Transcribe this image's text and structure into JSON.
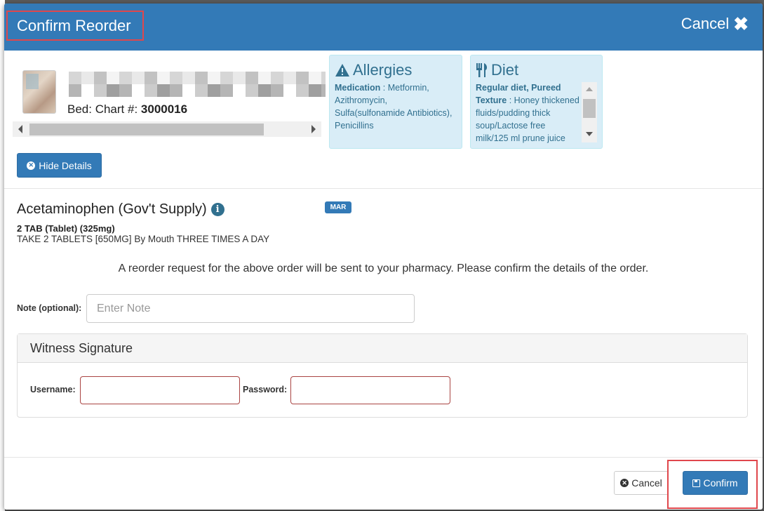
{
  "header": {
    "title": "Confirm Reorder",
    "cancel_label": "Cancel"
  },
  "patient": {
    "bed_label": "Bed: Chart #:",
    "chart_number": "3000016"
  },
  "allergies": {
    "title": "Allergies",
    "label": "Medication",
    "value": ": Metformin, Azithromycin, Sulfa(sulfonamide Antibiotics), Penicillins"
  },
  "diet": {
    "title": "Diet",
    "diet_type": "Regular diet, Pureed",
    "texture_label": "Texture",
    "texture_value": ": Honey thickened fluids/pudding thick soup/Lactose free milk/125 ml prune juice"
  },
  "hide_details_label": "Hide Details",
  "order": {
    "drug_name": "Acetaminophen (Gov't Supply)",
    "badge": "MAR",
    "dose": "2 TAB (Tablet) (325mg)",
    "instructions": "TAKE 2 TABLETS [650MG] By Mouth THREE TIMES A DAY"
  },
  "notice": "A reorder request for the above order will be sent to your pharmacy. Please confirm the details of the order.",
  "note": {
    "label": "Note (optional):",
    "placeholder": "Enter Note",
    "value": ""
  },
  "witness": {
    "title": "Witness Signature",
    "username_label": "Username:",
    "password_label": "Password:"
  },
  "footer": {
    "cancel_label": "Cancel",
    "confirm_label": "Confirm"
  },
  "colors": {
    "primary": "#337ab7",
    "info_bg": "#d9edf7",
    "info_text": "#31708f",
    "highlight_box": "#e0474c",
    "error_border": "#a94442"
  },
  "icons": {
    "header_cancel": "close-icon",
    "allergies": "warning-triangle-icon",
    "diet": "utensils-icon",
    "hide_details": "circle-x-icon",
    "drug_info": "info-circle-icon",
    "footer_cancel": "circle-x-icon",
    "confirm": "floppy-disk-icon"
  }
}
